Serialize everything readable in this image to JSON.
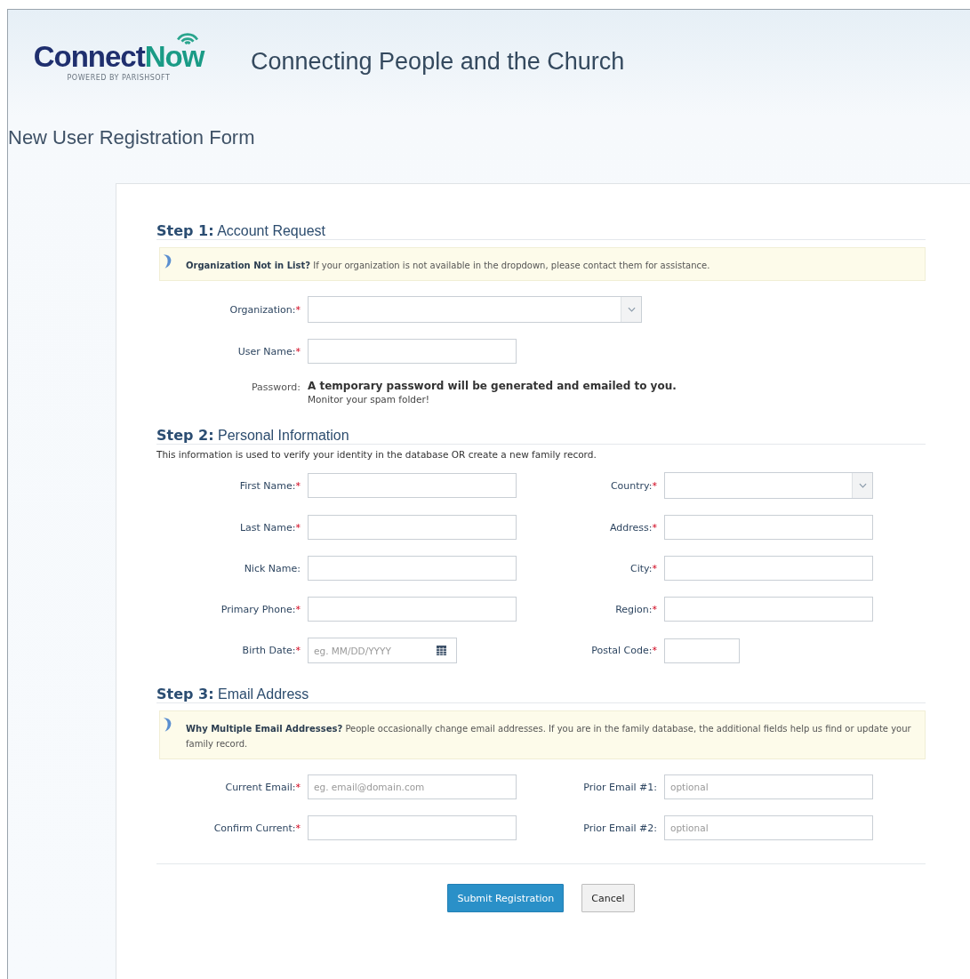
{
  "header": {
    "logo": {
      "word_1": "Connect",
      "word_2": "Now",
      "tagline": "POWERED BY PARISHSOFT"
    },
    "title": "Connecting People and the Church"
  },
  "page_title": "New User Registration Form",
  "steps": [
    {
      "number": "Step 1:",
      "title": "Account Request",
      "kind": "single",
      "note": "**Organization Not in List?** If your organization is not available in the dropdown, please contact them for assistance.",
      "fields": [
        {
          "label": "Organization:",
          "mark": "*",
          "kind": "select"
        },
        {
          "label": "User Name:",
          "mark": "*",
          "kind": "text"
        },
        {
          "label": "Password:",
          "kind": "info",
          "text": "A temporary password will be generated and emailed to you.",
          "hint": "Monitor your spam folder!"
        }
      ]
    },
    {
      "number": "Step 2:",
      "title": "Personal Information",
      "kind": "double",
      "intro": "This information is used to verify your identity in the database OR create a new family record.",
      "fields": [
        {
          "label": "First Name:",
          "mark": "*",
          "kind": "text"
        },
        {
          "label": "Country:",
          "mark": "*",
          "kind": "select"
        },
        {
          "label": "Last Name:",
          "mark": "*",
          "kind": "text"
        },
        {
          "label": "Address:",
          "mark": "*",
          "kind": "text"
        },
        {
          "label": "Nick Name:",
          "kind": "text"
        },
        {
          "label": "City:",
          "mark": "*",
          "kind": "text"
        },
        {
          "label": "Primary Phone:",
          "mark": "*",
          "kind": "text"
        },
        {
          "label": "Region:",
          "mark": "*",
          "kind": "text"
        },
        {
          "label": "Birth Date:",
          "mark": "*",
          "kind": "date",
          "placeholder": "eg. MM/DD/YYYY"
        },
        {
          "label": "Postal Code:",
          "mark": "*",
          "kind": "short"
        }
      ]
    },
    {
      "number": "Step 3:",
      "title": "Email Address",
      "kind": "double",
      "note": "**Why Multiple Email Addresses?** People occasionally change email addresses. If you are in the family database, the additional fields help us find or update your family record.",
      "fields": [
        {
          "label": "Current Email:",
          "mark": "*",
          "kind": "text",
          "placeholder": "eg. email@domain.com"
        },
        {
          "label": "Prior Email #1:",
          "kind": "text",
          "placeholder": "optional"
        },
        {
          "label": "Confirm Current:",
          "mark": "*",
          "kind": "text"
        },
        {
          "label": "Prior Email #2:",
          "kind": "text",
          "placeholder": "optional"
        }
      ]
    }
  ],
  "buttons": [
    {
      "label": "Submit Registration",
      "kind": "primary"
    },
    {
      "label": "Cancel",
      "kind": "secondary"
    }
  ]
}
